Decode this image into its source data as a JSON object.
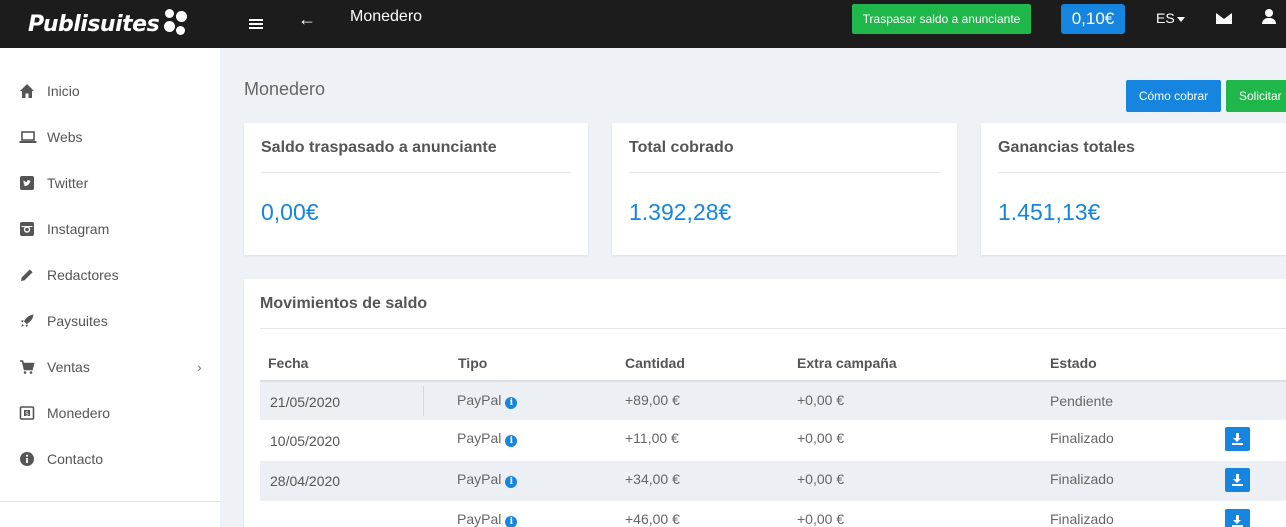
{
  "topbar": {
    "logo_text": "Publisuites",
    "page_title": "Monedero",
    "transfer_button": "Traspasar saldo a anunciante",
    "balance": "0,10€",
    "language": "ES"
  },
  "sidebar": {
    "items": [
      {
        "label": "Inicio",
        "icon": "home-icon"
      },
      {
        "label": "Webs",
        "icon": "laptop-icon"
      },
      {
        "label": "Twitter",
        "icon": "twitter-icon"
      },
      {
        "label": "Instagram",
        "icon": "instagram-icon"
      },
      {
        "label": "Redactores",
        "icon": "pencil-icon"
      },
      {
        "label": "Paysuites",
        "icon": "rocket-icon"
      },
      {
        "label": "Ventas",
        "icon": "cart-icon"
      },
      {
        "label": "Monedero",
        "icon": "wallet-icon"
      },
      {
        "label": "Contacto",
        "icon": "info-icon"
      }
    ]
  },
  "main": {
    "title": "Monedero",
    "how_to_collect_button": "Cómo cobrar",
    "request_button": "Solicitar",
    "cards": [
      {
        "title": "Saldo traspasado a anunciante",
        "value": "0,00€"
      },
      {
        "title": "Total cobrado",
        "value": "1.392,28€"
      },
      {
        "title": "Ganancias totales",
        "value": "1.451,13€"
      }
    ],
    "movements": {
      "title": "Movimientos de saldo",
      "headers": {
        "date": "Fecha",
        "type": "Tipo",
        "amount": "Cantidad",
        "extra": "Extra campaña",
        "status": "Estado"
      },
      "rows": [
        {
          "date": "21/05/2020",
          "type": "PayPal",
          "amount": "+89,00 €",
          "extra": "+0,00 €",
          "status": "Pendiente",
          "download": false
        },
        {
          "date": "10/05/2020",
          "type": "PayPal",
          "amount": "+11,00 €",
          "extra": "+0,00 €",
          "status": "Finalizado",
          "download": true
        },
        {
          "date": "28/04/2020",
          "type": "PayPal",
          "amount": "+34,00 €",
          "extra": "+0,00 €",
          "status": "Finalizado",
          "download": true
        },
        {
          "date": "",
          "type": "PayPal",
          "amount": "+46,00 €",
          "extra": "+0,00 €",
          "status": "Finalizado",
          "download": true
        }
      ]
    }
  },
  "colors": {
    "topbar": "#1c1c1c",
    "accent_blue": "#1685e0",
    "accent_green": "#1fb64a",
    "background": "#eef1f6"
  }
}
